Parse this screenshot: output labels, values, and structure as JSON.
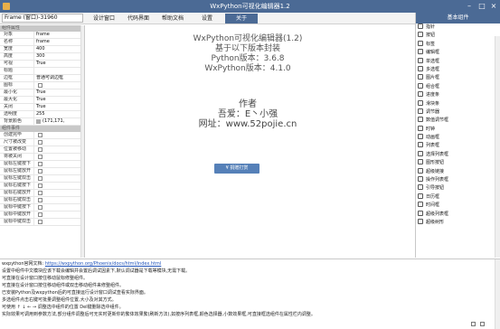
{
  "window": {
    "title": "WxPython可视化编辑器1.2"
  },
  "topbar": {
    "frame_select": "Frame (窗口)-31960",
    "tabs": [
      "设计窗口",
      "代码界面",
      "帮助文档",
      "设置",
      "关于"
    ],
    "active_tab": "关于"
  },
  "properties": {
    "sections": [
      {
        "title": "组件属性",
        "rows": [
          {
            "name": "对象",
            "value": "frame"
          },
          {
            "name": "名称",
            "value": "frame"
          },
          {
            "name": "宽度",
            "value": "400"
          },
          {
            "name": "高度",
            "value": "300"
          },
          {
            "name": "可视",
            "value": "True"
          },
          {
            "name": "标题",
            "value": ""
          },
          {
            "name": "边框",
            "value": "普通可调边框"
          },
          {
            "name": "图标",
            "value": "",
            "checkbox": true
          },
          {
            "name": "最小化",
            "value": "True"
          },
          {
            "name": "最大化",
            "value": "True"
          },
          {
            "name": "关闭",
            "value": "True"
          },
          {
            "name": "透明度",
            "value": "255"
          },
          {
            "name": "背景颜色",
            "value": "(171,171,",
            "swatch": true
          }
        ]
      },
      {
        "title": "组件事件",
        "rows": [
          {
            "name": "创建完毕",
            "checkbox": true
          },
          {
            "name": "尺寸被改变",
            "checkbox": true
          },
          {
            "name": "位置被移动",
            "checkbox": true
          },
          {
            "name": "将被关闭",
            "checkbox": true
          },
          {
            "name": "鼠标左键按下",
            "checkbox": true
          },
          {
            "name": "鼠标左键放开",
            "checkbox": true
          },
          {
            "name": "鼠标左键双击",
            "checkbox": true
          },
          {
            "name": "鼠标右键按下",
            "checkbox": true
          },
          {
            "name": "鼠标右键放开",
            "checkbox": true
          },
          {
            "name": "鼠标右键双击",
            "checkbox": true
          },
          {
            "name": "鼠标中键按下",
            "checkbox": true
          },
          {
            "name": "鼠标中键放开",
            "checkbox": true
          },
          {
            "name": "鼠标中键双击",
            "checkbox": true
          }
        ]
      }
    ]
  },
  "about": {
    "lines": [
      "WxPython可视化编辑器(1.2)",
      "基于以下版本封装",
      "Python版本：3.6.8",
      "WxPython版本：4.1.0"
    ],
    "author_title": "作者",
    "author_lines": [
      "吾爱：E丶小强",
      "网址：www.52pojie.cn"
    ],
    "support_button": "¥ 捐赠打赏"
  },
  "controls": {
    "header": "基本组件",
    "items": [
      "指针",
      "按钮",
      "标签",
      "编辑框",
      "单选框",
      "多选框",
      "图片框",
      "组合框",
      "进度条",
      "滑块条",
      "调节器",
      "数值调节框",
      "时钟",
      "动画框",
      "列表框",
      "选择列表框",
      "图形按钮",
      "超级链接",
      "操作列表框",
      "引导按钮",
      "日历框",
      "时间框",
      "超级列表框",
      "超级树形"
    ]
  },
  "log": {
    "doc_label": "wxpython官网文档:",
    "doc_link": "https://wxpython.org/Phoenix/docs/html/index.html",
    "lines": [
      "设置中组件中文模块应该下载会编辑并会置后调试因素下,默认调试器是下载等模块,无需下载。",
      "可直接在设计窗口按住移动鼠标修整组件。",
      "可直接在设计窗口按住移动组件或双击移动组件来修整组件。",
      "已安装Python及wxpython后的可直接运行设计窗口调试查看实际界面。",
      "多选组件点击右键可批量调整组件位置,大小及对其方式。",
      "可使用 ↑ ↓ ← → 调整选中组件的位置 Del键删除选中组件。",
      "实际效果可调用到参数方法,部分组件调整后可无实时更新你的繁体效果繁(刷新方法),如按序列表框,颜色选择器,小数效果框,可直接框选组件在属性栏内调整。"
    ]
  },
  "colors": {
    "accent": "#4b6a95",
    "button": "#5580b8"
  }
}
